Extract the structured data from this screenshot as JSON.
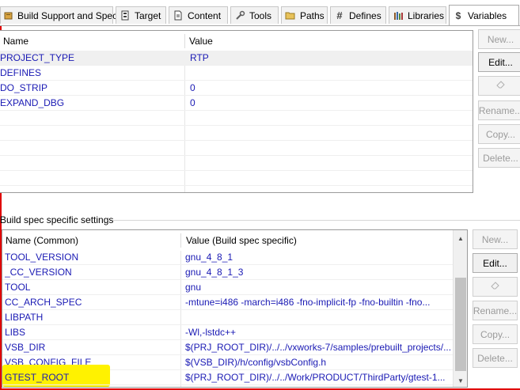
{
  "tabs": [
    {
      "label": "Build Support and Specs",
      "icon": "build-support-icon"
    },
    {
      "label": "Target",
      "icon": "target-icon"
    },
    {
      "label": "Content",
      "icon": "content-icon"
    },
    {
      "label": "Tools",
      "icon": "tools-icon"
    },
    {
      "label": "Paths",
      "icon": "folder-icon"
    },
    {
      "label": "Defines",
      "icon": "hash-icon"
    },
    {
      "label": "Libraries",
      "icon": "libraries-icon"
    },
    {
      "label": "Variables",
      "icon": "dollar-icon",
      "icon_glyph": "$"
    }
  ],
  "variables_table": {
    "headers": {
      "name": "Name",
      "value": "Value"
    },
    "rows": [
      {
        "name": "PROJECT_TYPE",
        "value": "RTP"
      },
      {
        "name": "DEFINES",
        "value": ""
      },
      {
        "name": "DO_STRIP",
        "value": "0"
      },
      {
        "name": "EXPAND_DBG",
        "value": "0"
      }
    ]
  },
  "top_buttons": {
    "new": "New...",
    "edit": "Edit...",
    "rename": "Rename...",
    "copy": "Copy...",
    "delete": "Delete..."
  },
  "build_spec_section_label": "Build spec specific settings",
  "build_spec_table": {
    "headers": {
      "name": "Name (Common)",
      "value": "Value (Build spec specific)"
    },
    "rows": [
      {
        "name": "TOOL_VERSION",
        "value": "gnu_4_8_1"
      },
      {
        "name": "_CC_VERSION",
        "value": "gnu_4_8_1_3"
      },
      {
        "name": "TOOL",
        "value": "gnu"
      },
      {
        "name": "CC_ARCH_SPEC",
        "value": "-mtune=i486 -march=i486 -fno-implicit-fp -fno-builtin -fno..."
      },
      {
        "name": "LIBPATH",
        "value": ""
      },
      {
        "name": "LIBS",
        "value": " -Wl,-lstdc++"
      },
      {
        "name": "VSB_DIR",
        "value": "$(PRJ_ROOT_DIR)/../../vxworks-7/samples/prebuilt_projects/..."
      },
      {
        "name": "VSB_CONFIG_FILE",
        "value": "$(VSB_DIR)/h/config/vsbConfig.h"
      },
      {
        "name": "GTEST_ROOT",
        "value": "$(PRJ_ROOT_DIR)/../../Work/PRODUCT/ThirdParty/gtest-1..."
      }
    ]
  },
  "bottom_buttons": {
    "new": "New...",
    "edit": "Edit...",
    "rename": "Rename...",
    "copy": "Copy...",
    "delete": "Delete..."
  },
  "colors": {
    "link_text": "#1a1ab4",
    "highlight": "#fff200",
    "red_edge": "#e00000"
  }
}
